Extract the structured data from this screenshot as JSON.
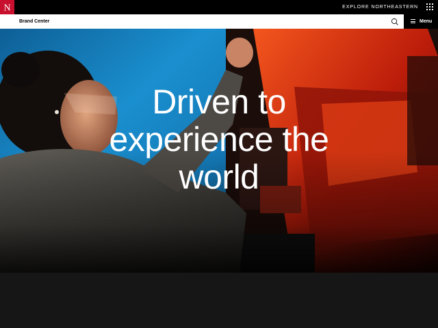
{
  "topbar": {
    "logo_letter": "N",
    "explore_label": "EXPLORE NORTHEASTERN",
    "colors": {
      "logo_bg": "#c8102e",
      "bar_bg": "#000000"
    }
  },
  "nav": {
    "brand_label": "Brand Center",
    "menu_label": "Menu"
  },
  "hero": {
    "headline_lines": [
      "Driven to",
      "experience the",
      "world"
    ]
  },
  "icons": {
    "logo": "northeastern-n-logo",
    "grid": "apps-grid-icon",
    "search": "search-icon",
    "menu": "hamburger-icon"
  }
}
